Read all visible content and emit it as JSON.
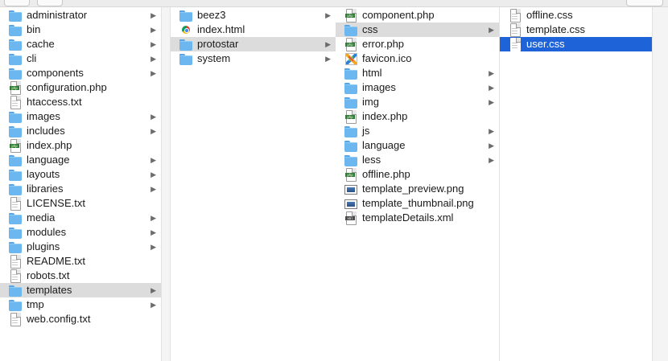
{
  "window": {
    "columns": [
      {
        "items": [
          {
            "label": "administrator",
            "icon": "folder-icon",
            "folder": true
          },
          {
            "label": "bin",
            "icon": "folder-icon",
            "folder": true
          },
          {
            "label": "cache",
            "icon": "folder-icon",
            "folder": true
          },
          {
            "label": "cli",
            "icon": "folder-icon",
            "folder": true
          },
          {
            "label": "components",
            "icon": "folder-icon",
            "folder": true
          },
          {
            "label": "configuration.php",
            "icon": "php-file-icon",
            "folder": false
          },
          {
            "label": "htaccess.txt",
            "icon": "text-file-icon",
            "folder": false
          },
          {
            "label": "images",
            "icon": "folder-icon",
            "folder": true
          },
          {
            "label": "includes",
            "icon": "folder-icon",
            "folder": true
          },
          {
            "label": "index.php",
            "icon": "php-file-icon",
            "folder": false
          },
          {
            "label": "language",
            "icon": "folder-icon",
            "folder": true
          },
          {
            "label": "layouts",
            "icon": "folder-icon",
            "folder": true
          },
          {
            "label": "libraries",
            "icon": "folder-icon",
            "folder": true
          },
          {
            "label": "LICENSE.txt",
            "icon": "text-file-icon",
            "folder": false
          },
          {
            "label": "media",
            "icon": "folder-icon",
            "folder": true
          },
          {
            "label": "modules",
            "icon": "folder-icon",
            "folder": true
          },
          {
            "label": "plugins",
            "icon": "folder-icon",
            "folder": true
          },
          {
            "label": "README.txt",
            "icon": "text-file-icon",
            "folder": false
          },
          {
            "label": "robots.txt",
            "icon": "text-file-icon",
            "folder": false
          },
          {
            "label": "templates",
            "icon": "folder-icon",
            "folder": true,
            "selected": "gray"
          },
          {
            "label": "tmp",
            "icon": "folder-icon",
            "folder": true
          },
          {
            "label": "web.config.txt",
            "icon": "text-file-icon",
            "folder": false
          }
        ]
      },
      {
        "items": [
          {
            "label": "beez3",
            "icon": "folder-icon",
            "folder": true
          },
          {
            "label": "index.html",
            "icon": "html-file-icon",
            "folder": false
          },
          {
            "label": "protostar",
            "icon": "folder-icon",
            "folder": true,
            "selected": "gray"
          },
          {
            "label": "system",
            "icon": "folder-icon",
            "folder": true
          }
        ]
      },
      {
        "items": [
          {
            "label": "component.php",
            "icon": "php-file-icon",
            "folder": false
          },
          {
            "label": "css",
            "icon": "folder-icon",
            "folder": true,
            "selected": "gray"
          },
          {
            "label": "error.php",
            "icon": "php-file-icon",
            "folder": false
          },
          {
            "label": "favicon.ico",
            "icon": "ico-file-icon",
            "folder": false
          },
          {
            "label": "html",
            "icon": "folder-icon",
            "folder": true
          },
          {
            "label": "images",
            "icon": "folder-icon",
            "folder": true
          },
          {
            "label": "img",
            "icon": "folder-icon",
            "folder": true
          },
          {
            "label": "index.php",
            "icon": "php-file-icon",
            "folder": false
          },
          {
            "label": "js",
            "icon": "folder-icon",
            "folder": true
          },
          {
            "label": "language",
            "icon": "folder-icon",
            "folder": true
          },
          {
            "label": "less",
            "icon": "folder-icon",
            "folder": true
          },
          {
            "label": "offline.php",
            "icon": "php-file-icon",
            "folder": false
          },
          {
            "label": "template_preview.png",
            "icon": "image-file-icon",
            "folder": false
          },
          {
            "label": "template_thumbnail.png",
            "icon": "image-file-icon",
            "folder": false
          },
          {
            "label": "templateDetails.xml",
            "icon": "xml-file-icon",
            "folder": false
          }
        ]
      },
      {
        "items": [
          {
            "label": "offline.css",
            "icon": "text-file-icon",
            "folder": false
          },
          {
            "label": "template.css",
            "icon": "text-file-icon",
            "folder": false
          },
          {
            "label": "user.css",
            "icon": "text-file-icon",
            "folder": false,
            "selected": "blue"
          }
        ]
      }
    ],
    "colors": {
      "selection_blue": "#1f63d8",
      "selection_gray": "#dcdcdc",
      "folder": "#6cb7f0"
    }
  }
}
